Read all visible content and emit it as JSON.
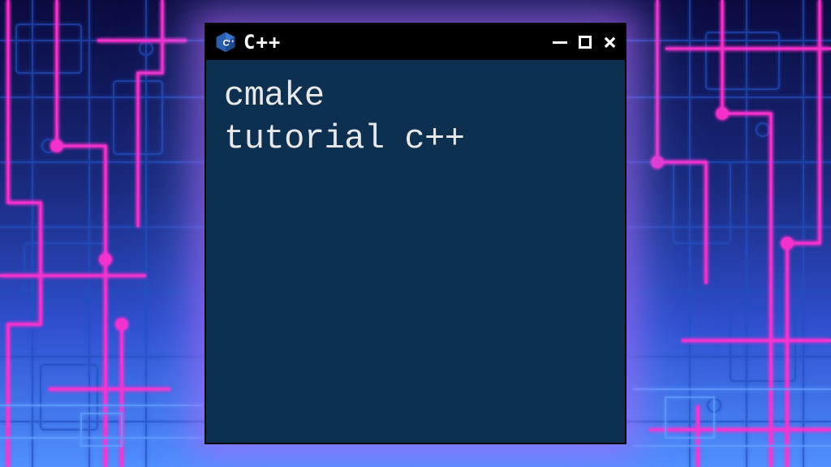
{
  "window": {
    "title": "C++",
    "icon_label": "C++",
    "controls": {
      "minimize": "minimize",
      "maximize": "maximize",
      "close": "close"
    }
  },
  "terminal": {
    "content": "cmake\ntutorial c++"
  },
  "colors": {
    "terminal_bg": "#0d3050",
    "titlebar_bg": "#000000",
    "text": "#e8e8e8",
    "glow_pink": "#ff40d0",
    "glow_blue": "#4080ff"
  }
}
